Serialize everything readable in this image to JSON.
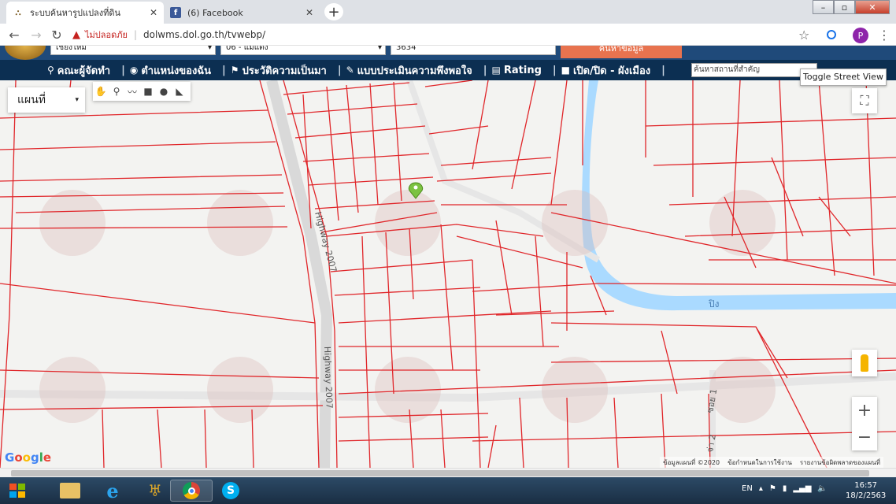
{
  "browser": {
    "tabs": [
      {
        "label": "ระบบค้นหารูปแปลงที่ดิน",
        "active": true
      },
      {
        "label": "(6) Facebook",
        "active": false
      }
    ],
    "security_label": "ไม่ปลอดภัย",
    "url": "dolwms.dol.go.th/tvwebp/",
    "profile_initial": "P"
  },
  "search_form": {
    "province": "เชียงใหม่",
    "district": "06 - แม่แตง",
    "parcel_no": "3634",
    "search_button": "ค้นหาข้อมูล"
  },
  "menu": {
    "items": [
      {
        "label": "คณะผู้จัดทำ",
        "icon": "team-icon"
      },
      {
        "label": "ตำแหน่งของฉัน",
        "icon": "location-icon"
      },
      {
        "label": "ประวัติความเป็นมา",
        "icon": "history-icon"
      },
      {
        "label": "แบบประเมินความพึงพอใจ",
        "icon": "survey-icon"
      },
      {
        "label": "Rating",
        "icon": "rating-icon"
      },
      {
        "label": "เปิด/ปิด - ผังเมือง",
        "icon": "checkbox-icon"
      }
    ],
    "place_search_placeholder": "ค้นหาสถานที่สำคัญ"
  },
  "map": {
    "map_type": "แผนที่",
    "toggle_street_view": "Toggle Street View",
    "road_labels": [
      "Highway 2007",
      "Highway 2007",
      "ปิง",
      "ซอย 1",
      "จ่า 2"
    ],
    "google": "Google",
    "attribution": [
      "ข้อมูลแผนที่ ©2020",
      "ข้อกำหนดในการใช้งาน",
      "รายงานข้อผิดพลาดของแผนที่"
    ]
  },
  "taskbar": {
    "language": "EN",
    "time": "16:57",
    "date": "18/2/2563"
  },
  "colors": {
    "parcel_line": "#e0262a",
    "river": "#aadaff",
    "menubar": "#0c2f52",
    "search_button": "#e8734f"
  }
}
